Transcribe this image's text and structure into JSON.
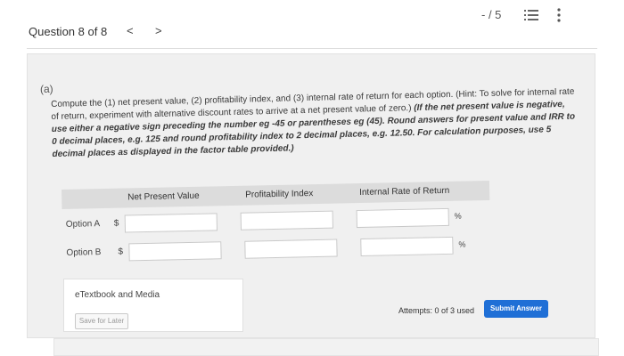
{
  "header": {
    "question_label": "Question 8 of 8",
    "prev_glyph": "<",
    "next_glyph": ">",
    "score": "- / 5"
  },
  "part": {
    "label": "(a)",
    "instructions_a": "Compute the (1) net present value, (2) profitability index, and (3) internal rate of return for each option. (Hint: To solve for internal rate of return, experiment with alternative discount rates to arrive at a net present value of zero.) ",
    "instructions_b": "(If the net present value is negative, use either a negative sign preceding the number eg -45 or parentheses eg (45). Round answers for present value and IRR to 0 decimal places, e.g. 125 and round profitability index to 2 decimal places, e.g. 12.50. For calculation purposes, use 5 decimal places as displayed in the factor table provided.)"
  },
  "table": {
    "columns": [
      "Net Present Value",
      "Profitability Index",
      "Internal Rate of Return"
    ],
    "rows": [
      {
        "label": "Option A",
        "currency": "$",
        "npv": "",
        "pi": "",
        "irr": "",
        "pct": "%"
      },
      {
        "label": "Option B",
        "currency": "$",
        "npv": "",
        "pi": "",
        "irr": "",
        "pct": "%"
      }
    ]
  },
  "footer": {
    "etextbook_label": "eTextbook and Media",
    "save_label": "Save for Later",
    "attempts": "Attempts: 0 of 3 used",
    "submit_label": "Submit Answer"
  },
  "colors": {
    "accent": "#1f6fd6",
    "panel": "#f0f0f0",
    "header_bar": "#dcdcdc"
  },
  "icons": [
    "list-icon",
    "more-vertical-icon"
  ]
}
